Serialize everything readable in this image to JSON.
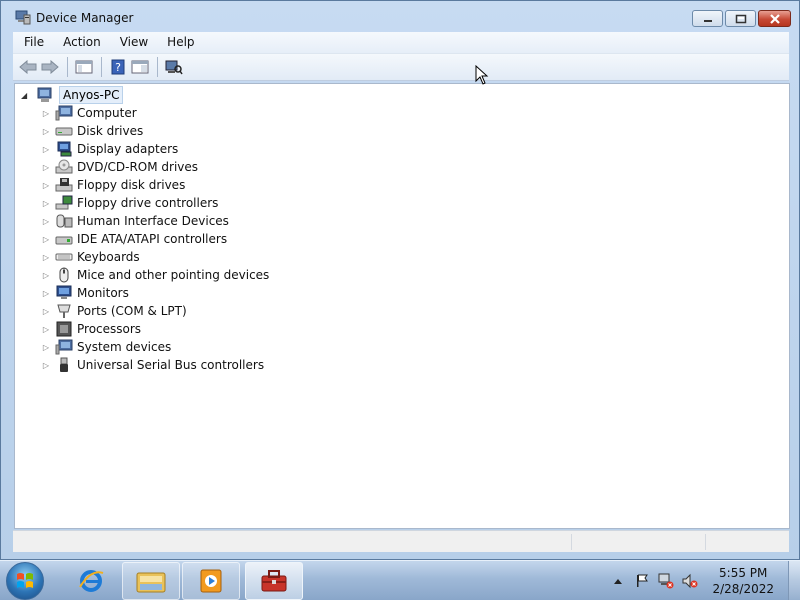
{
  "window": {
    "title": "Device Manager",
    "icon": "device-manager-icon"
  },
  "menu": {
    "items": [
      {
        "label": "File"
      },
      {
        "label": "Action"
      },
      {
        "label": "View"
      },
      {
        "label": "Help"
      }
    ]
  },
  "toolbar": {
    "buttons": [
      "back-icon",
      "forward-icon",
      "show-hide-console-tree-icon",
      "help-icon",
      "properties-pane-icon",
      "scan-hardware-changes-icon"
    ]
  },
  "tree": {
    "root": {
      "label": "Anyos-PC",
      "expanded": true
    },
    "categories": [
      {
        "label": "Computer",
        "icon": "computer-icon"
      },
      {
        "label": "Disk drives",
        "icon": "disk-drive-icon"
      },
      {
        "label": "Display adapters",
        "icon": "display-adapter-icon"
      },
      {
        "label": "DVD/CD-ROM drives",
        "icon": "dvd-drive-icon"
      },
      {
        "label": "Floppy disk drives",
        "icon": "floppy-drive-icon"
      },
      {
        "label": "Floppy drive controllers",
        "icon": "floppy-controller-icon"
      },
      {
        "label": "Human Interface Devices",
        "icon": "hid-icon"
      },
      {
        "label": "IDE ATA/ATAPI controllers",
        "icon": "ide-controller-icon"
      },
      {
        "label": "Keyboards",
        "icon": "keyboard-icon"
      },
      {
        "label": "Mice and other pointing devices",
        "icon": "mouse-icon"
      },
      {
        "label": "Monitors",
        "icon": "monitor-icon"
      },
      {
        "label": "Ports (COM & LPT)",
        "icon": "port-icon"
      },
      {
        "label": "Processors",
        "icon": "processor-icon"
      },
      {
        "label": "System devices",
        "icon": "system-devices-icon"
      },
      {
        "label": "Universal Serial Bus controllers",
        "icon": "usb-icon"
      }
    ]
  },
  "taskbar": {
    "apps": [
      "internet-explorer-icon",
      "windows-explorer-icon",
      "media-player-icon",
      "device-manager-toolbox-icon"
    ],
    "tray_icons": [
      "show-hidden-icons-icon",
      "action-center-flag-icon",
      "network-disconnected-icon",
      "volume-muted-icon"
    ],
    "clock": {
      "time": "5:55 PM",
      "date": "2/28/2022"
    }
  },
  "colors": {
    "accent": "#b9d1ea",
    "window_frame": "#c7dbf2",
    "close_button": "#c74a36"
  }
}
